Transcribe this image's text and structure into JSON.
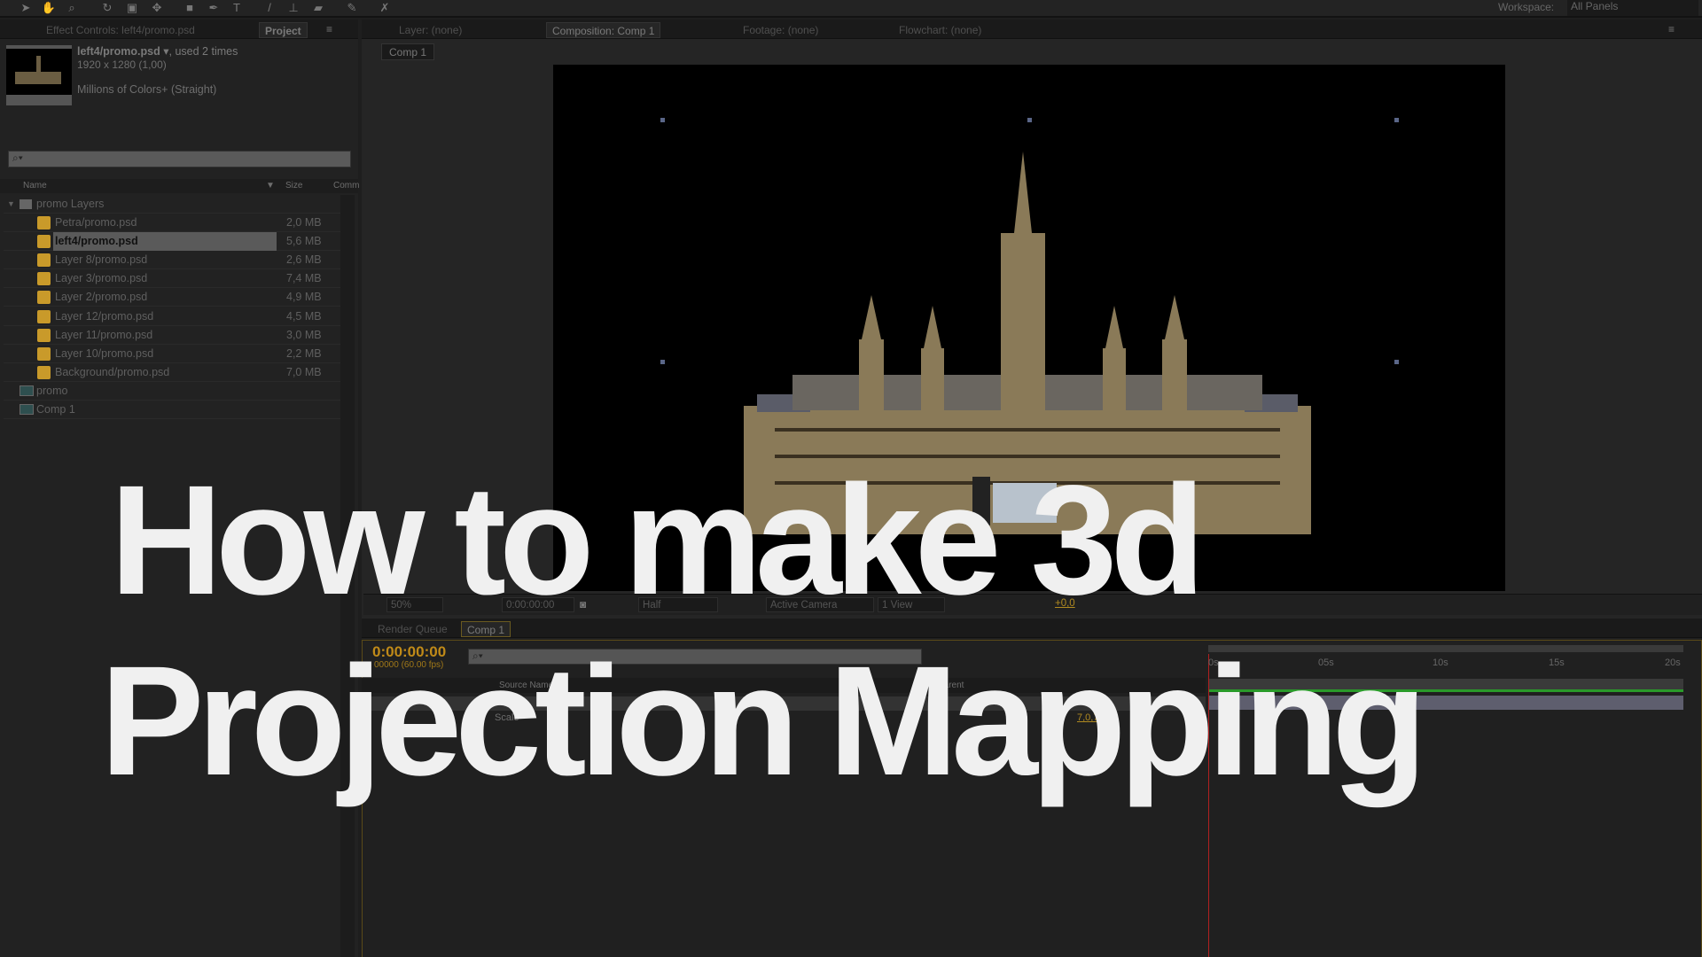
{
  "toolbar": {
    "workspace_label": "Workspace:",
    "workspace_value": "All Panels"
  },
  "left_panel": {
    "tabs": [
      "Effect Controls: left4/promo.psd",
      "Project"
    ],
    "info": {
      "name": "left4/promo.psd",
      "usage": ", used 2 times",
      "dimensions": "1920 x 1280 (1,00)",
      "colors": "Millions of Colors+ (Straight)"
    },
    "columns": {
      "name": "Name",
      "size": "Size",
      "comment": "Comm"
    },
    "folder": "promo Layers",
    "items": [
      {
        "name": "Petra/promo.psd",
        "size": "2,0 MB"
      },
      {
        "name": "left4/promo.psd",
        "size": "5,6 MB",
        "selected": true
      },
      {
        "name": "Layer 8/promo.psd",
        "size": "2,6 MB"
      },
      {
        "name": "Layer 3/promo.psd",
        "size": "7,4 MB"
      },
      {
        "name": "Layer 2/promo.psd",
        "size": "4,9 MB"
      },
      {
        "name": "Layer 12/promo.psd",
        "size": "4,5 MB"
      },
      {
        "name": "Layer 11/promo.psd",
        "size": "3,0 MB"
      },
      {
        "name": "Layer 10/promo.psd",
        "size": "2,2 MB"
      },
      {
        "name": "Background/promo.psd",
        "size": "7,0 MB"
      }
    ],
    "comps": [
      "promo",
      "Comp 1"
    ]
  },
  "viewer": {
    "tabs": [
      "Layer: (none)",
      "Composition: Comp 1",
      "Footage: (none)",
      "Flowchart: (none)"
    ],
    "comp_button": "Comp 1",
    "zoom": "50%",
    "timecode": "0:00:00:00",
    "resolution": "Half",
    "camera": "Active Camera",
    "views": "1 View",
    "exposure": "+0,0"
  },
  "timeline": {
    "tabs": [
      "Render Queue",
      "Comp 1"
    ],
    "timecode": "0:00:00:00",
    "frames": "00000 (60.00 fps)",
    "col_source": "Source Name",
    "col_parent": "Parent",
    "property": "Scale",
    "property_value": "7,0,7",
    "ruler": [
      "0s",
      "05s",
      "10s",
      "15s",
      "20s"
    ]
  },
  "overlay": {
    "line1": "How to make 3d",
    "line2": "Projection Mapping"
  }
}
